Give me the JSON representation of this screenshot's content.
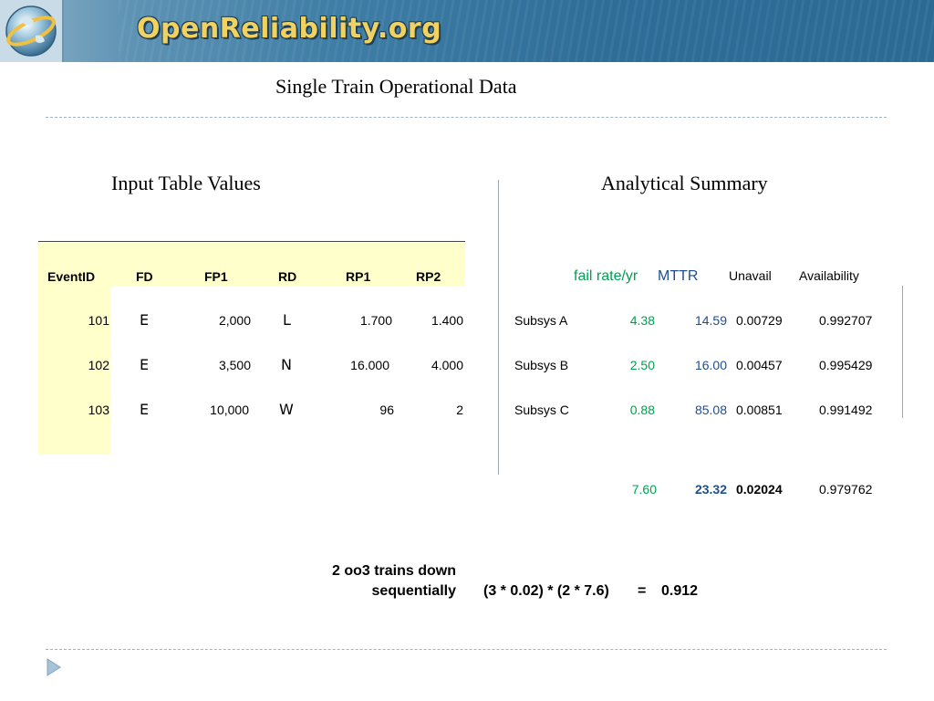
{
  "header": {
    "site_name": "OpenReliability.org"
  },
  "title": "Single Train Operational Data",
  "left": {
    "heading": "Input Table Values",
    "columns": [
      "EventID",
      "FD",
      "FP1",
      "RD",
      "RP1",
      "RP2"
    ],
    "rows": [
      [
        "101",
        "E",
        "2,000",
        "L",
        "1.700",
        "1.400"
      ],
      [
        "102",
        "E",
        "3,500",
        "N",
        "16.000",
        "4.000"
      ],
      [
        "103",
        "E",
        "10,000",
        "W",
        "96",
        "2"
      ]
    ]
  },
  "right": {
    "heading": "Analytical Summary",
    "columns": [
      "fail rate/yr",
      "MTTR",
      "Unavail",
      "Availability"
    ],
    "rows": [
      [
        "Subsys A",
        "4.38",
        "14.59",
        "0.00729",
        "0.992707"
      ],
      [
        "Subsys B",
        "2.50",
        "16.00",
        "0.00457",
        "0.995429"
      ],
      [
        "Subsys C",
        "0.88",
        "85.08",
        "0.00851",
        "0.991492"
      ]
    ],
    "totals": [
      "7.60",
      "23.32",
      "0.02024",
      "0.979762"
    ]
  },
  "formula": {
    "label_line1": "2 oo3 trains down",
    "label_line2": "sequentially",
    "expression": "(3 * 0.02) * (2 * 7.6)",
    "equals": "=",
    "result": "0.912"
  },
  "colors": {
    "green": "#00a050",
    "blue": "#1f4e8c",
    "table_fill": "#ffffcc",
    "banner": "#2e6d98",
    "logo_text": "#f1d160"
  }
}
